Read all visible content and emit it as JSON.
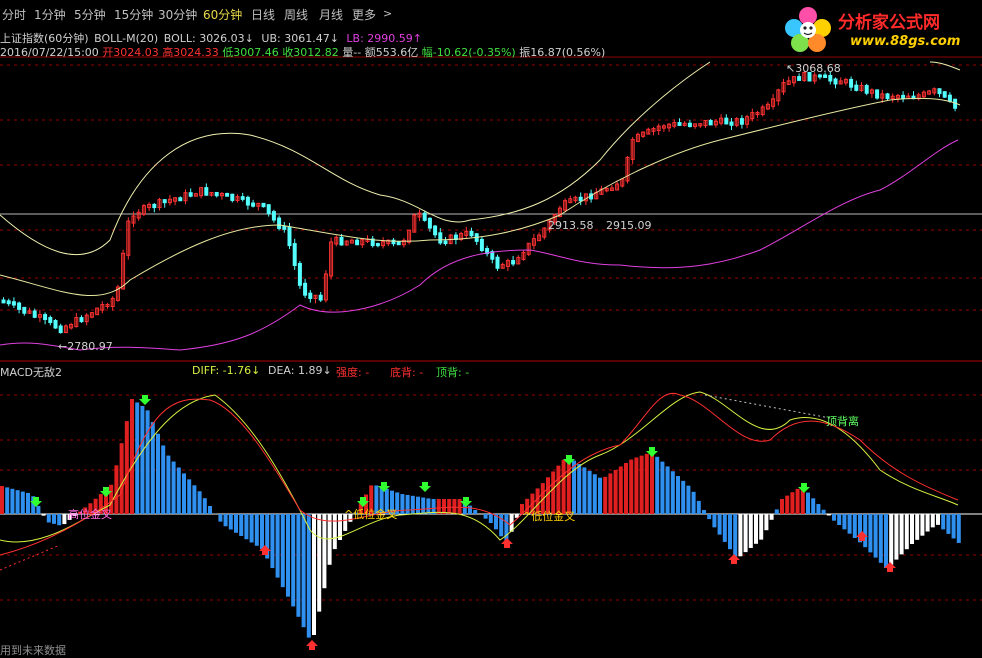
{
  "toolbar": {
    "tabs": [
      {
        "label": "分时",
        "active": false
      },
      {
        "label": "1分钟",
        "active": false
      },
      {
        "label": "5分钟",
        "active": false
      },
      {
        "label": "15分钟",
        "active": false
      },
      {
        "label": "30分钟",
        "active": false
      },
      {
        "label": "60分钟",
        "active": true
      },
      {
        "label": "日线",
        "active": false
      },
      {
        "label": "周线",
        "active": false
      },
      {
        "label": "月线",
        "active": false
      },
      {
        "label": "更多",
        "active": false
      }
    ],
    "more_icon": "chevron-right-icon"
  },
  "logo": {
    "title": "分析家公式网",
    "url": "www.88gs.com"
  },
  "info_line": {
    "symbol": "上证指数(60分钟)",
    "indicator": "BOLL-M(20)",
    "boll": "BOLL: 3026.03↓",
    "ub": "UB: 3061.47↓",
    "lb": "LB: 2990.59↑"
  },
  "quote_line": {
    "datetime": "2016/07/22/15:00",
    "open": "开3024.03",
    "high": "高3024.33",
    "low": "低3007.46",
    "close": "收3012.82",
    "volume": "量--",
    "amount": "额553.6亿",
    "change": "幅-10.62(-0.35%)",
    "amplitude": "振16.87(0.56%)"
  },
  "price_labels": {
    "high_mark": "3068.68",
    "low_mark": "2780.97",
    "level_left": "2913.58",
    "level_right": "2915.09"
  },
  "macd_line": {
    "name": "MACD无敌2",
    "diff": "DIFF: -1.76↓",
    "dea": "DEA: 1.89↓",
    "strength": "强度: -",
    "bottom_div": "底背: -",
    "top_div": "顶背: -"
  },
  "macd_annotations": {
    "cross1": "高位金叉",
    "cross2": "低位金叉",
    "cross3": "低位金叉",
    "top_div_label": "顶背离"
  },
  "bottom_note": "用到未来数据",
  "colors": {
    "up": "#ff3232",
    "down": "#54ffff",
    "boll_mid": "#e8e8a0",
    "boll_ub": "#f0f0b0",
    "boll_lb": "#e040e0",
    "macd_pos": "#e02020",
    "macd_neg": "#3090f0",
    "diff": "#d8f040",
    "dea": "#ff3030",
    "active_tab": "#e8d84a",
    "gridline": "#9a0000"
  }
}
